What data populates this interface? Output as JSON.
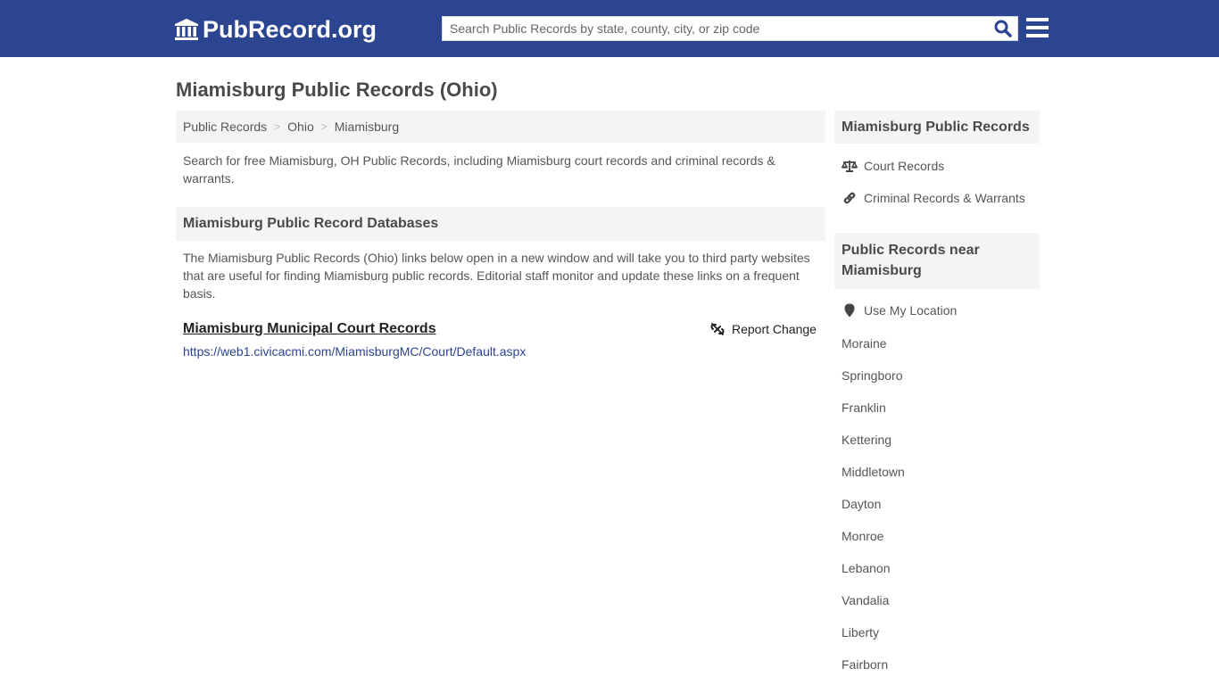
{
  "header": {
    "logo_text": "PubRecord.org",
    "logo_icon": "courthouse-icon",
    "search_placeholder": "Search Public Records by state, county, city, or zip code",
    "search_value": "",
    "search_icon": "search-icon",
    "menu_icon": "hamburger-menu-icon",
    "colors": {
      "bar": "#2c4591",
      "search_icon": "#2c4591"
    }
  },
  "page": {
    "title": "Miamisburg Public Records (Ohio)",
    "breadcrumb": [
      {
        "label": "Public Records"
      },
      {
        "label": "Ohio"
      },
      {
        "label": "Miamisburg"
      }
    ],
    "breadcrumb_separator": ">",
    "intro": "Search for free Miamisburg, OH Public Records, including Miamisburg court records and criminal records & warrants.",
    "databases_heading": "Miamisburg Public Record Databases",
    "databases_description": "The Miamisburg Public Records (Ohio) links below open in a new window and will take you to third party websites that are useful for finding Miamisburg public records. Editorial staff monitor and update these links on a frequent basis.",
    "records": [
      {
        "title": "Miamisburg Municipal Court Records",
        "url": "https://web1.civicacmi.com/MiamisburgMC/Court/Default.aspx",
        "report_label": "Report Change",
        "report_icon": "broken-link-icon"
      }
    ]
  },
  "sidebar": {
    "records_heading": "Miamisburg Public Records",
    "record_links": [
      {
        "label": "Court Records",
        "icon": "scales-icon"
      },
      {
        "label": "Criminal Records & Warrants",
        "icon": "link-icon"
      }
    ],
    "nearby_heading": "Public Records near Miamisburg",
    "use_location_label": "Use My Location",
    "use_location_icon": "map-marker-icon",
    "nearby_cities": [
      "Moraine",
      "Springboro",
      "Franklin",
      "Kettering",
      "Middletown",
      "Dayton",
      "Monroe",
      "Lebanon",
      "Vandalia",
      "Liberty",
      "Fairborn"
    ]
  }
}
